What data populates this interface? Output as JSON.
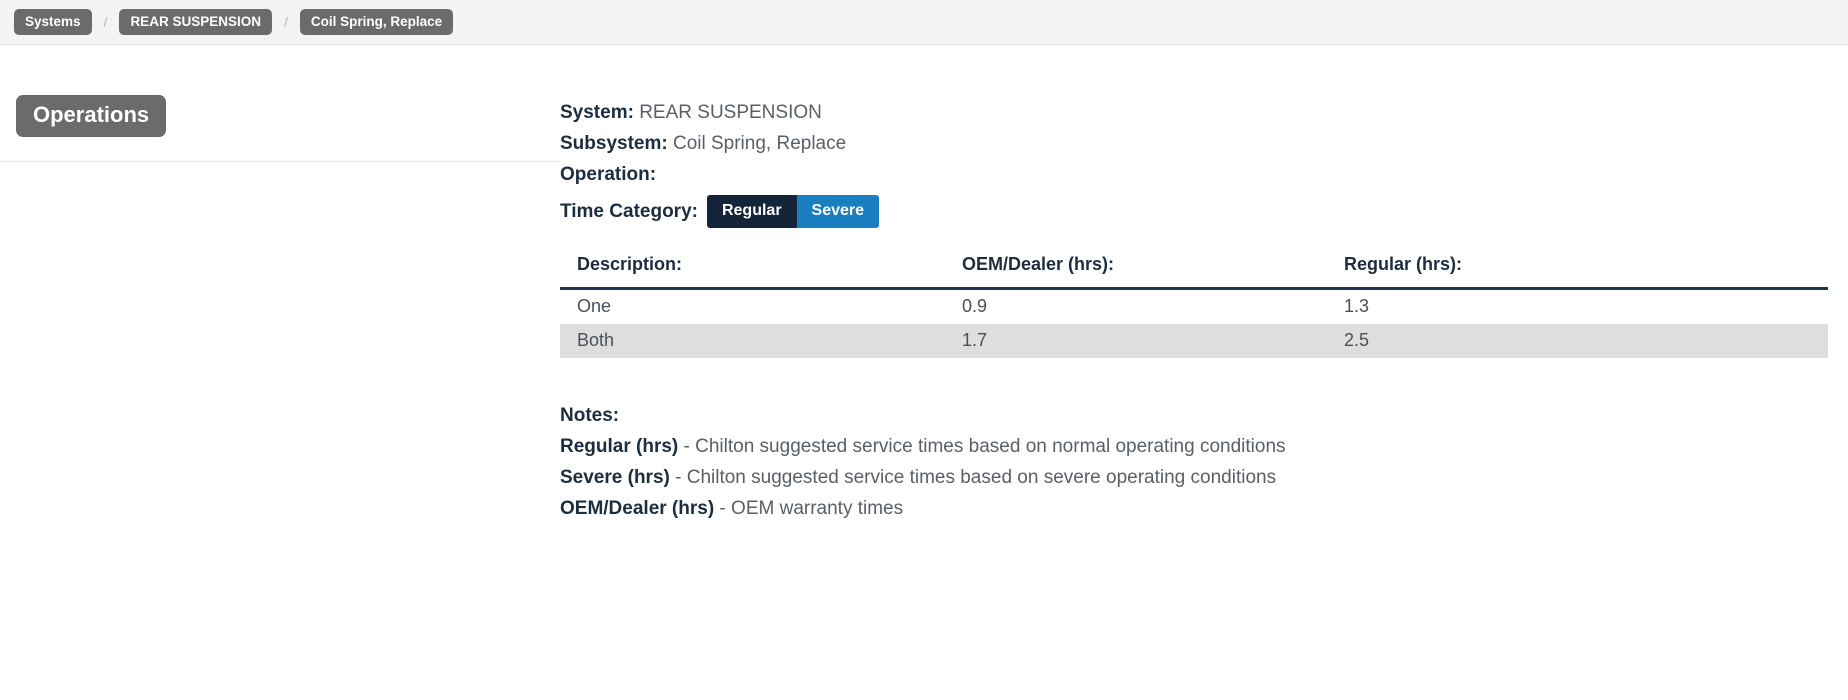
{
  "breadcrumb": {
    "separator": "/",
    "items": [
      {
        "label": "Systems"
      },
      {
        "label": "REAR SUSPENSION"
      },
      {
        "label": "Coil Spring, Replace"
      }
    ]
  },
  "left_panel": {
    "header": "Operations"
  },
  "details": {
    "system_label": "System:",
    "system_value": "REAR SUSPENSION",
    "subsystem_label": "Subsystem:",
    "subsystem_value": "Coil Spring, Replace",
    "operation_label": "Operation:",
    "operation_value": "",
    "time_category_label": "Time Category:",
    "time_category_options": [
      {
        "label": "Regular",
        "selected": true
      },
      {
        "label": "Severe",
        "selected": false
      }
    ]
  },
  "table": {
    "columns": [
      "Description:",
      "OEM/Dealer (hrs):",
      "Regular (hrs):"
    ],
    "rows": [
      {
        "description": "One",
        "oem_dealer": "0.9",
        "regular": "1.3"
      },
      {
        "description": "Both",
        "oem_dealer": "1.7",
        "regular": "2.5"
      }
    ]
  },
  "notes": {
    "title": "Notes:",
    "items": [
      {
        "term": "Regular (hrs)",
        "desc": " - Chilton suggested service times based on normal operating conditions"
      },
      {
        "term": "Severe (hrs)",
        "desc": " - Chilton suggested service times based on severe operating conditions"
      },
      {
        "term": "OEM/Dealer (hrs)",
        "desc": " - OEM warranty times"
      }
    ]
  },
  "colors": {
    "crumb_bg": "#6d6b6a",
    "toggle_active": "#14253a",
    "toggle_inactive": "#1a7fc1",
    "header_rule": "#1d3557",
    "stripe": "#dedede"
  }
}
